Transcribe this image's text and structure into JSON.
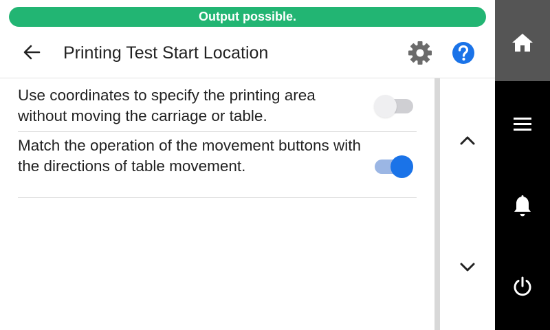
{
  "status": {
    "text": "Output possible.",
    "color": "#22b573"
  },
  "header": {
    "title": "Printing Test Start Location",
    "icons": [
      "back-arrow-icon",
      "gear-icon",
      "help-icon"
    ]
  },
  "settings": [
    {
      "label": "Use coordinates to specify the printing area without moving the carriage or table.",
      "enabled": false
    },
    {
      "label": "Match the operation of the movement buttons with the directions of table movement.",
      "enabled": true
    }
  ],
  "scroll": {
    "icons": [
      "chevron-up-icon",
      "chevron-down-icon"
    ]
  },
  "sidebar": {
    "icons": [
      "home-icon",
      "menu-icon",
      "bell-icon",
      "power-icon"
    ]
  },
  "colors": {
    "accent": "#1a73e8",
    "toggle_on_track": "#9bb6e4",
    "sidebar": "#000000",
    "sidebar_active": "#555555"
  }
}
